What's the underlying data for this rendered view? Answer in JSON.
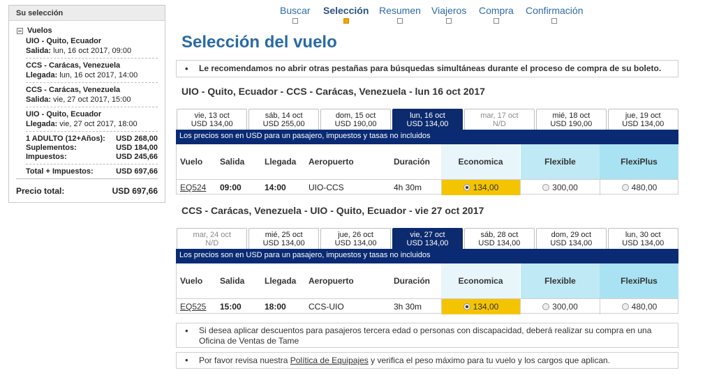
{
  "sidebar": {
    "header": "Su selección",
    "toggle_label": "Vuelos",
    "segments": [
      {
        "title": "UIO - Quito, Ecuador",
        "label": "Salida:",
        "value": "lun, 16 oct 2017, 09:00"
      },
      {
        "title": "CCS - Carácas, Venezuela",
        "label": "Llegada:",
        "value": "lun, 16 oct 2017, 14:00"
      },
      {
        "title": "CCS - Carácas, Venezuela",
        "label": "Salida:",
        "value": "vie, 27 oct 2017, 15:00"
      },
      {
        "title": "UIO - Quito, Ecuador",
        "label": "Llegada:",
        "value": "vie, 27 oct 2017, 18:00"
      }
    ],
    "costs": [
      {
        "label": "1 ADULTO (12+Años):",
        "value": "USD 268,00"
      },
      {
        "label": "Suplementos:",
        "value": "USD 184,00"
      },
      {
        "label": "Impuestos:",
        "value": "USD 245,66"
      }
    ],
    "total_label": "Total + Impuestos:",
    "total_value": "USD 697,66",
    "price_label": "Precio total:",
    "price_value": "USD 697,66"
  },
  "steps": [
    {
      "label": "Buscar",
      "active": false
    },
    {
      "label": "Selección",
      "active": true
    },
    {
      "label": "Resumen",
      "active": false
    },
    {
      "label": "Viajeros",
      "active": false
    },
    {
      "label": "Compra",
      "active": false
    },
    {
      "label": "Confirmación",
      "active": false
    }
  ],
  "page_title": "Selección del vuelo",
  "notice_top": "Le recomendamos no abrir otras pestañas para búsquedas simultáneas durante el proceso de compra de su boleto.",
  "price_note": "Los precios son en USD para un pasajero, impuestos y tasas no incluidos",
  "table_headers": {
    "vuelo": "Vuelo",
    "salida": "Salida",
    "llegada": "Llegada",
    "aeropuerto": "Aeropuerto",
    "duracion": "Duración",
    "economica": "Economica",
    "flexible": "Flexible",
    "flexiplus": "FlexiPlus"
  },
  "outbound": {
    "title": "UIO - Quito, Ecuador - CCS - Carácas, Venezuela - lun 16 oct 2017",
    "days": [
      {
        "date": "vie, 13 oct",
        "price": "USD 134,00",
        "state": "normal"
      },
      {
        "date": "sáb, 14 oct",
        "price": "USD 255,00",
        "state": "normal"
      },
      {
        "date": "dom, 15 oct",
        "price": "USD 190,00",
        "state": "normal"
      },
      {
        "date": "lun, 16 oct",
        "price": "USD 134,00",
        "state": "active"
      },
      {
        "date": "mar, 17 oct",
        "price": "N/D",
        "state": "disabled"
      },
      {
        "date": "mié, 18 oct",
        "price": "USD 190,00",
        "state": "normal"
      },
      {
        "date": "jue, 19 oct",
        "price": "USD 134,00",
        "state": "normal"
      }
    ],
    "flight": {
      "number": "EQ524",
      "salida": "09:00",
      "llegada": "14:00",
      "aeropuerto": "UIO-CCS",
      "duracion": "4h 30m",
      "economica": "134,00",
      "flexible": "300,00",
      "flexiplus": "480,00"
    }
  },
  "inbound": {
    "title": "CCS - Carácas, Venezuela - UIO - Quito, Ecuador - vie 27 oct 2017",
    "days": [
      {
        "date": "mar, 24 oct",
        "price": "N/D",
        "state": "disabled"
      },
      {
        "date": "mié, 25 oct",
        "price": "USD 134,00",
        "state": "normal"
      },
      {
        "date": "jue, 26 oct",
        "price": "USD 134,00",
        "state": "normal"
      },
      {
        "date": "vie, 27 oct",
        "price": "USD 134,00",
        "state": "active"
      },
      {
        "date": "sáb, 28 oct",
        "price": "USD 134,00",
        "state": "normal"
      },
      {
        "date": "dom, 29 oct",
        "price": "USD 134,00",
        "state": "normal"
      },
      {
        "date": "lun, 30 oct",
        "price": "USD 134,00",
        "state": "normal"
      }
    ],
    "flight": {
      "number": "EQ525",
      "salida": "15:00",
      "llegada": "18:00",
      "aeropuerto": "CCS-UIO",
      "duracion": "3h 30m",
      "economica": "134,00",
      "flexible": "300,00",
      "flexiplus": "480,00"
    }
  },
  "notice_discount": "Si desea aplicar descuentos para pasajeros tercera edad o personas con discapacidad, deberá realizar su compra en una Oficina de Ventas de Tame",
  "notice_baggage": {
    "before": "Por favor revisa nuestra",
    "link": "Política de Equipajes",
    "after": "y verifica el peso máximo para tu vuelo y los cargos que aplican."
  }
}
